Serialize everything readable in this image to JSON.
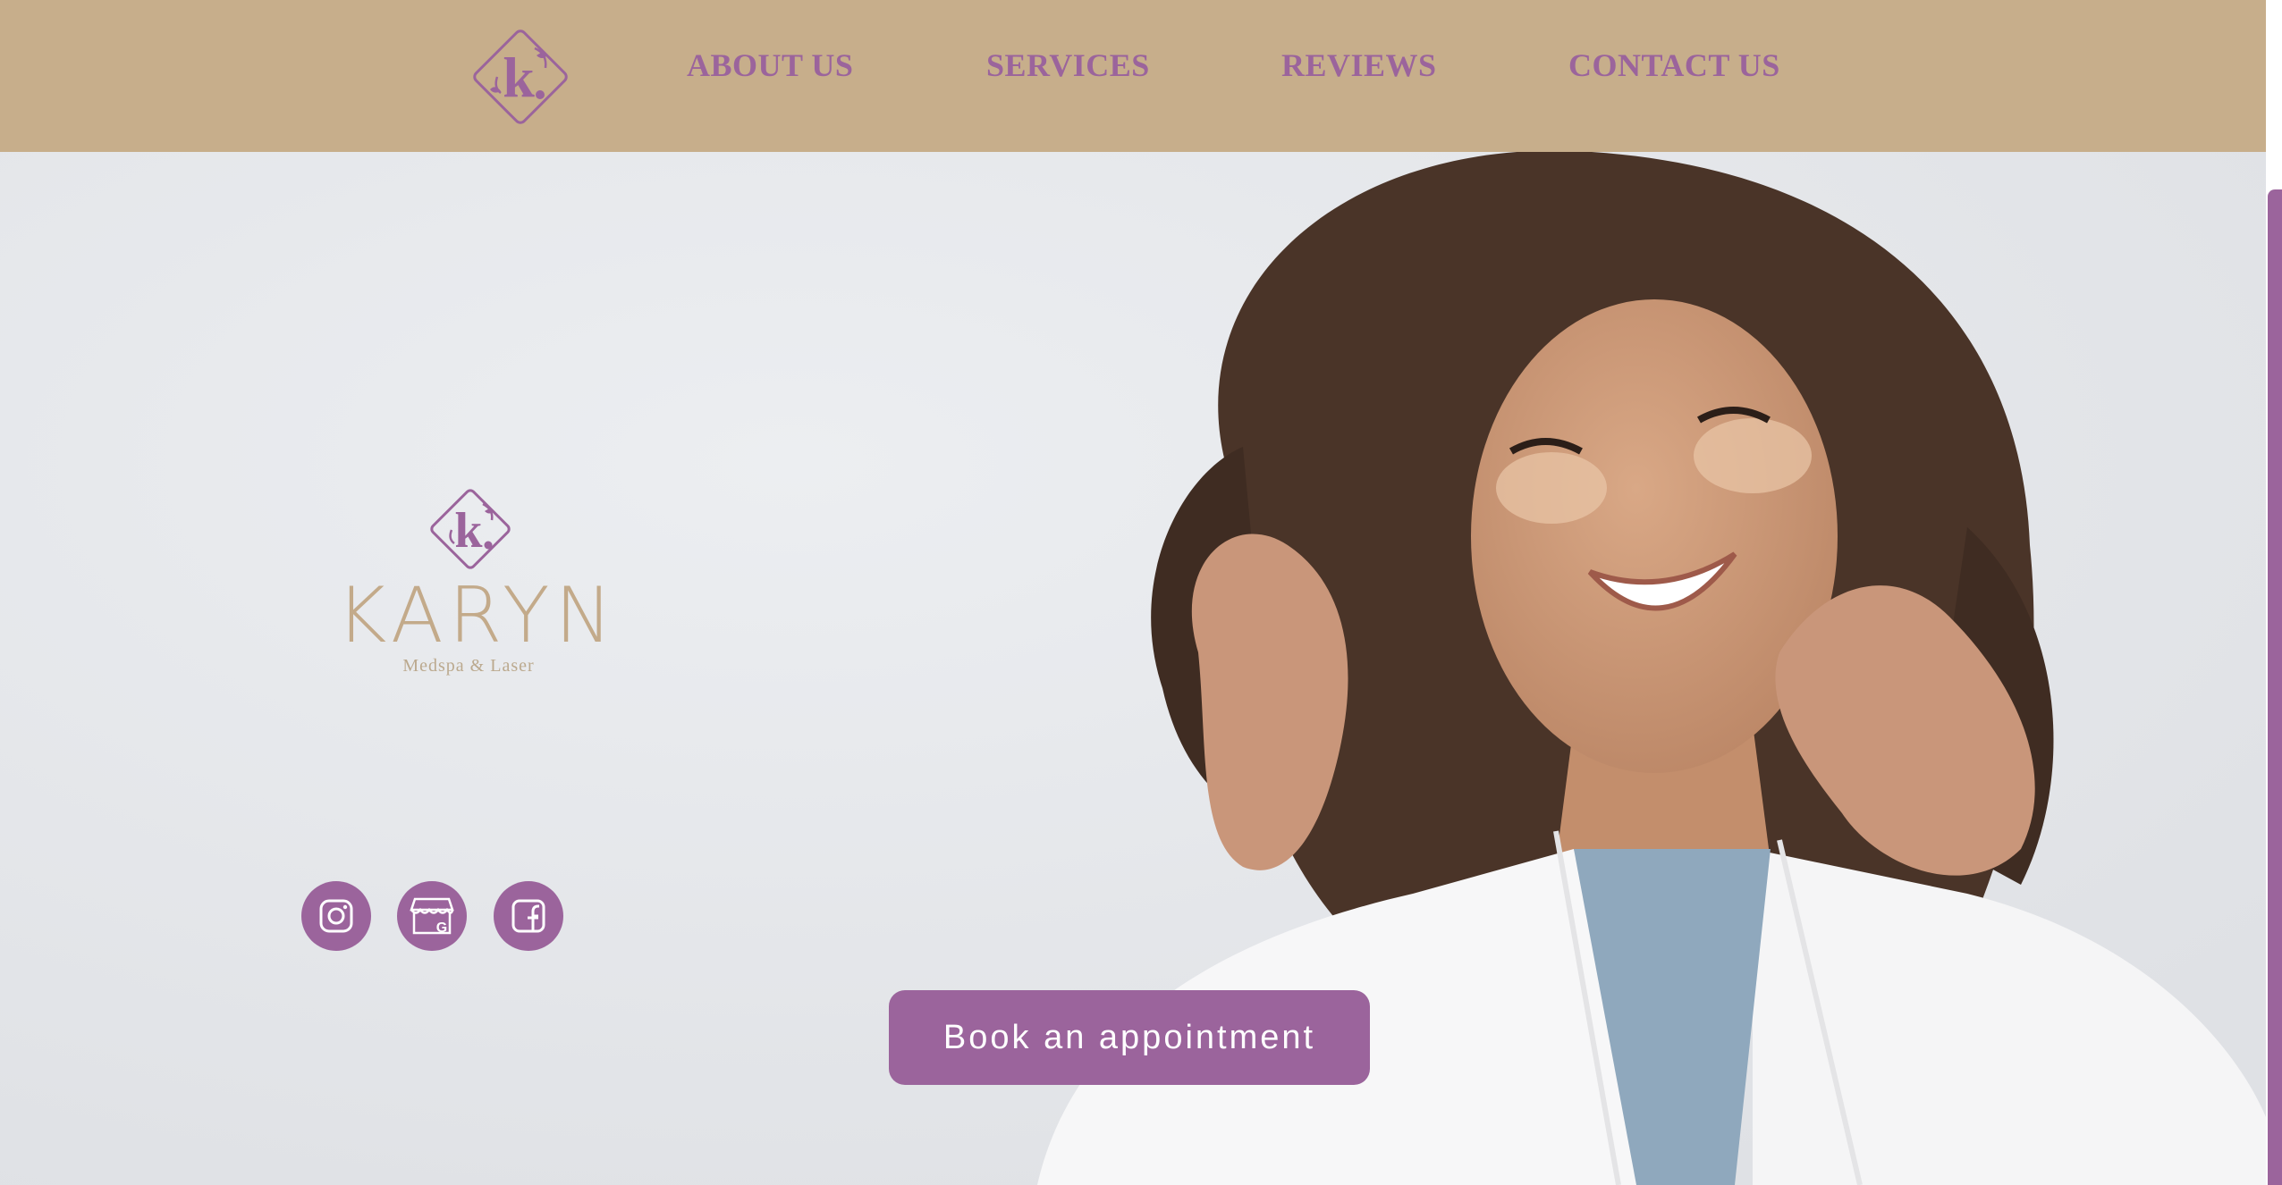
{
  "header": {
    "logo_letter": "k",
    "nav": [
      {
        "label": "ABOUT US"
      },
      {
        "label": "SERVICES"
      },
      {
        "label": "REVIEWS"
      },
      {
        "label": "CONTACT US"
      }
    ]
  },
  "brand": {
    "name": "KARYN",
    "tagline": "Medspa & Laser",
    "mark_letter": "k"
  },
  "social": [
    {
      "icon": "instagram-icon"
    },
    {
      "icon": "google-business-icon"
    },
    {
      "icon": "facebook-icon"
    }
  ],
  "cta": {
    "label": "Book an appointment"
  },
  "colors": {
    "header_bg": "#c7ae8b",
    "accent_purple": "#9b649c",
    "brand_tan": "#c3aa8a",
    "hero_bg": "#e3e5e9"
  }
}
